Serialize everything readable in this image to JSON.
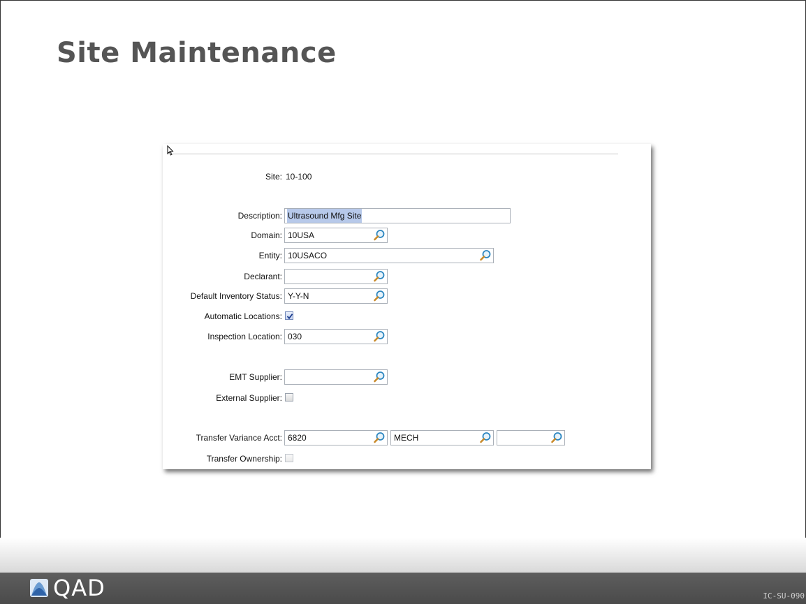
{
  "slide": {
    "title": "Site Maintenance",
    "brand": "QAD",
    "code": "IC-SU-090"
  },
  "form": {
    "site_label": "Site:",
    "site_value": "10-100",
    "description_label": "Description:",
    "description_value": "Ultrasound Mfg Site",
    "domain_label": "Domain:",
    "domain_value": "10USA",
    "entity_label": "Entity:",
    "entity_value": "10USACO",
    "declarant_label": "Declarant:",
    "declarant_value": "",
    "inventory_status_label": "Default Inventory Status:",
    "inventory_status_value": "Y-Y-N",
    "auto_locations_label": "Automatic Locations:",
    "auto_locations_checked": true,
    "inspection_location_label": "Inspection Location:",
    "inspection_location_value": "030",
    "emt_supplier_label": "EMT Supplier:",
    "emt_supplier_value": "",
    "external_supplier_label": "External Supplier:",
    "external_supplier_checked": false,
    "transfer_variance_label": "Transfer Variance Acct:",
    "transfer_variance_account": "6820",
    "transfer_variance_subaccount": "MECH",
    "transfer_variance_costcenter": "",
    "transfer_ownership_label": "Transfer Ownership:",
    "transfer_ownership_checked": false
  },
  "icons": {
    "lookup": "magnifier-icon",
    "checkmark": "checkmark-icon",
    "cursor": "pointer-cursor-icon",
    "logo": "qad-logo-icon"
  },
  "colors": {
    "title": "#555555",
    "footer": "#4f4f4f",
    "selection": "#b7c9ea",
    "field_border": "#aab0b8"
  }
}
